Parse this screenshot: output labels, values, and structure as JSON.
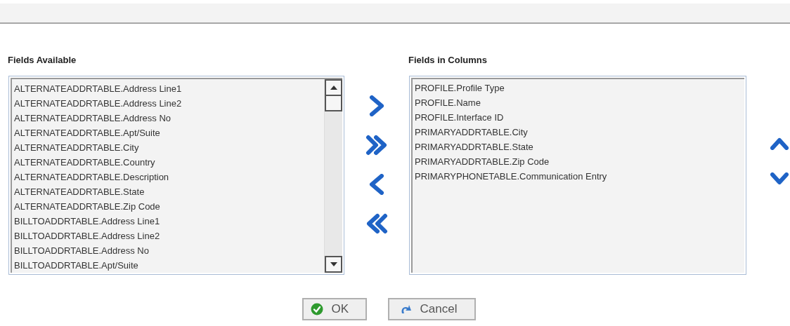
{
  "available": {
    "title": "Fields Available",
    "items": [
      "ALTERNATEADDRTABLE.Address Line1",
      "ALTERNATEADDRTABLE.Address Line2",
      "ALTERNATEADDRTABLE.Address No",
      "ALTERNATEADDRTABLE.Apt/Suite",
      "ALTERNATEADDRTABLE.City",
      "ALTERNATEADDRTABLE.Country",
      "ALTERNATEADDRTABLE.Description",
      "ALTERNATEADDRTABLE.State",
      "ALTERNATEADDRTABLE.Zip Code",
      "BILLTOADDRTABLE.Address Line1",
      "BILLTOADDRTABLE.Address Line2",
      "BILLTOADDRTABLE.Address No",
      "BILLTOADDRTABLE.Apt/Suite"
    ]
  },
  "columns": {
    "title": "Fields in Columns",
    "items": [
      "PROFILE.Profile Type",
      "PROFILE.Name",
      "PROFILE.Interface ID",
      "PRIMARYADDRTABLE.City",
      "PRIMARYADDRTABLE.State",
      "PRIMARYADDRTABLE.Zip Code",
      "PRIMARYPHONETABLE.Communication Entry"
    ]
  },
  "buttons": [
    {
      "kind": "ok",
      "label": "OK"
    },
    {
      "kind": "cancel",
      "label": "Cancel"
    }
  ]
}
